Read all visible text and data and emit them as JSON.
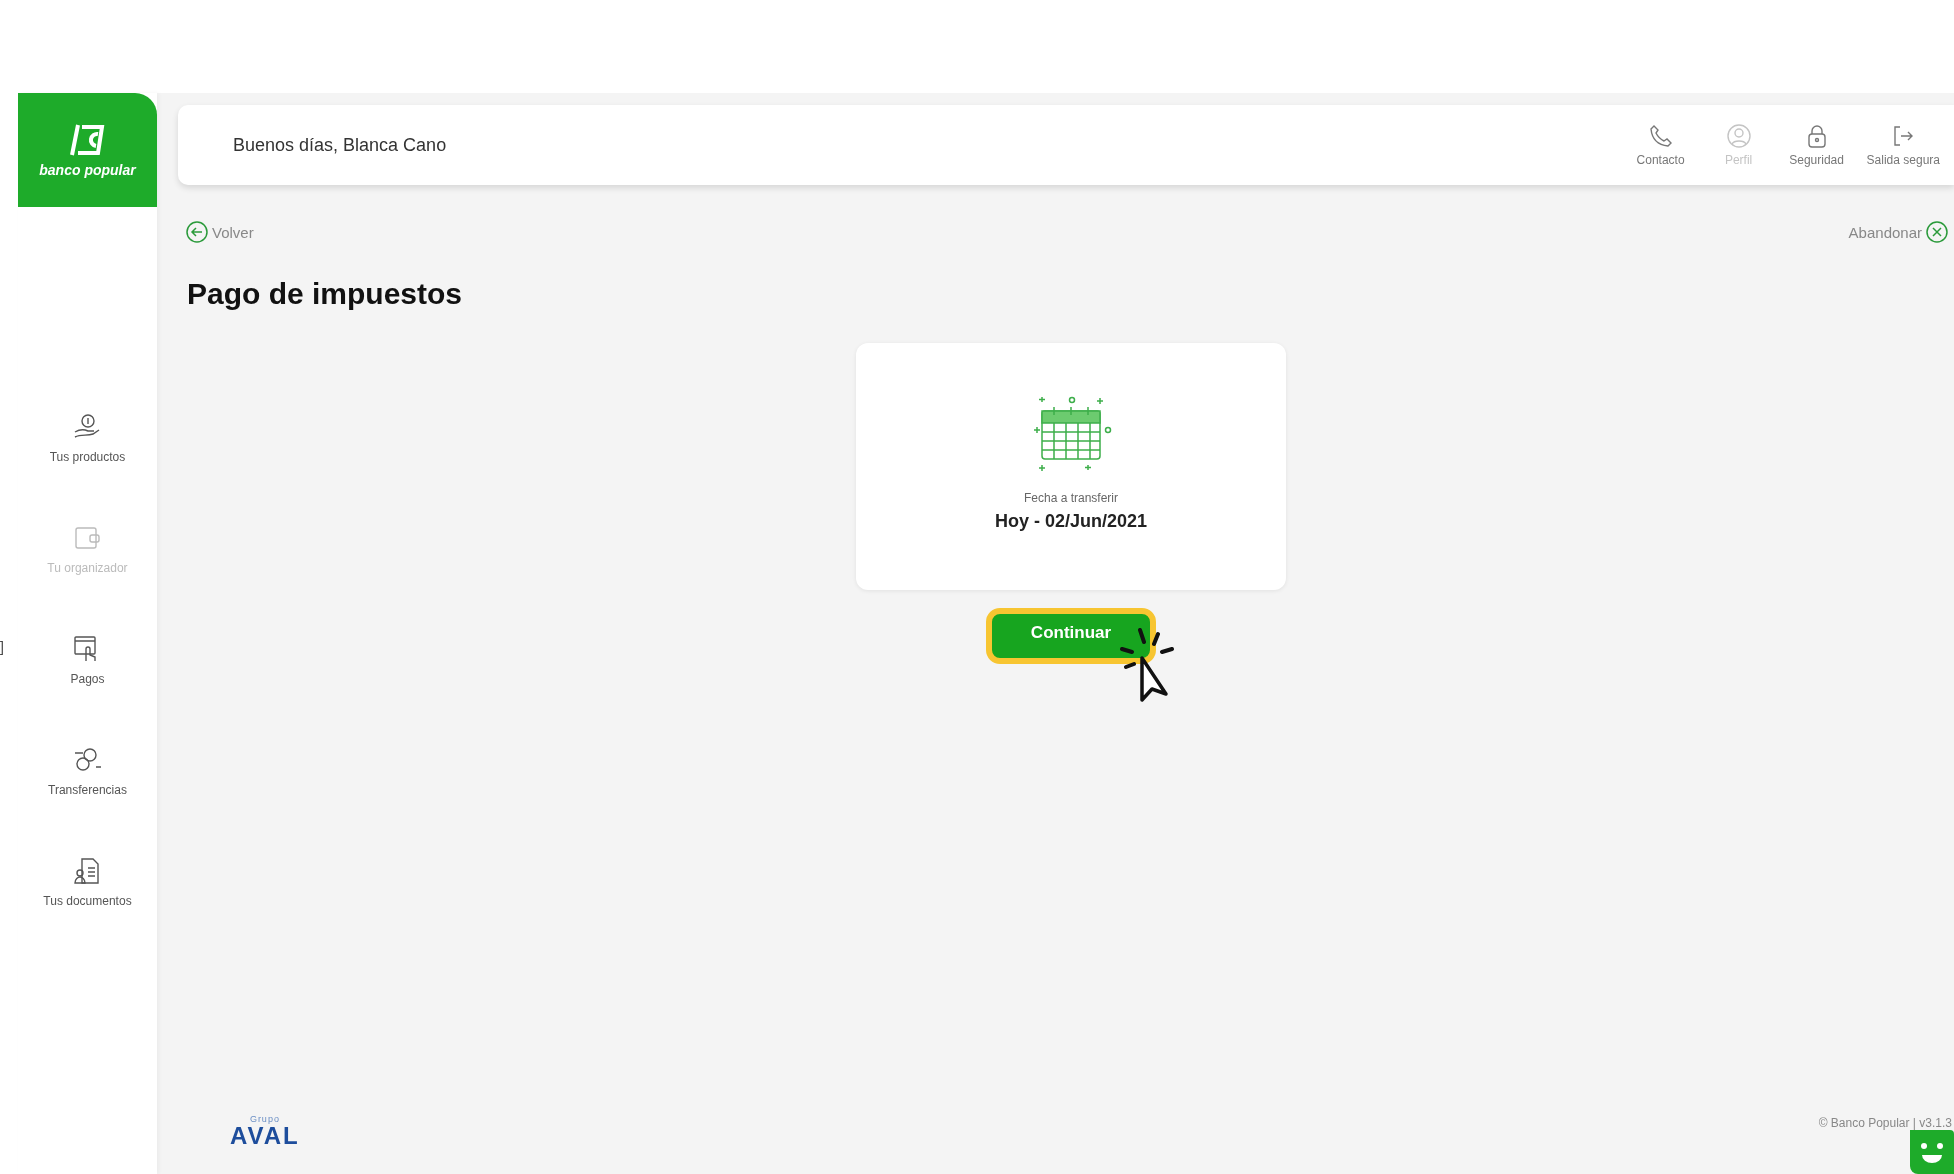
{
  "sidebar": {
    "logo_text": "banco popular",
    "edge_mark": "]",
    "items": [
      {
        "label": "Tus productos",
        "disabled": false
      },
      {
        "label": "Tu organizador",
        "disabled": true
      },
      {
        "label": "Pagos",
        "disabled": false
      },
      {
        "label": "Transferencias",
        "disabled": false
      },
      {
        "label": "Tus documentos",
        "disabled": false
      }
    ]
  },
  "header": {
    "greeting": "Buenos días, Blanca Cano",
    "nav": [
      {
        "label": "Contacto",
        "disabled": false
      },
      {
        "label": "Perfil",
        "disabled": true
      },
      {
        "label": "Seguridad",
        "disabled": false
      },
      {
        "label": "Salida segura",
        "disabled": false
      }
    ]
  },
  "back_link": "Volver",
  "abandon_link": "Abandonar",
  "title": "Pago de impuestos",
  "card": {
    "label": "Fecha a transferir",
    "value": "Hoy - 02/Jun/2021"
  },
  "continue_button": {
    "label": "Continuar",
    "highlighted": true
  },
  "footer": {
    "group_caption": "Grupo",
    "group_brand": "AVAL",
    "copyright": "© Banco Popular | v3.1.3"
  }
}
